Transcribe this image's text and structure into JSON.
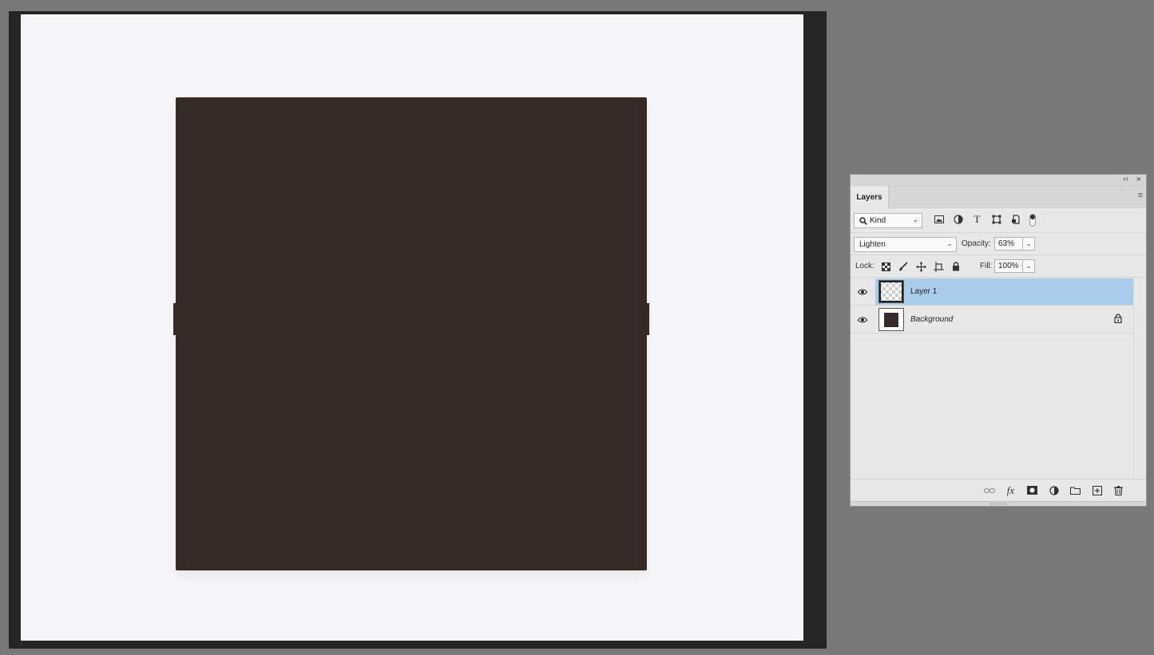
{
  "panel": {
    "tab_label": "Layers",
    "collapse_glyph": "‹‹",
    "close_glyph": "×",
    "menu_glyph": "≡"
  },
  "filter": {
    "kind_label": "Kind",
    "icons": [
      "image-filter-icon",
      "adjustment-filter-icon",
      "type-filter-icon",
      "shape-filter-icon",
      "smart-object-filter-icon"
    ]
  },
  "blend": {
    "mode": "Lighten",
    "opacity_label": "Opacity:",
    "opacity_value": "63%"
  },
  "lock": {
    "label": "Lock:",
    "fill_label": "Fill:",
    "fill_value": "100%"
  },
  "layers": [
    {
      "name": "Layer 1",
      "selected": true,
      "visible": true,
      "locked": false
    },
    {
      "name": "Background",
      "selected": false,
      "visible": true,
      "locked": true
    }
  ],
  "colors": {
    "canvas_fill": "#342a26",
    "selection": "#aacdec",
    "workspace": "#787878"
  }
}
